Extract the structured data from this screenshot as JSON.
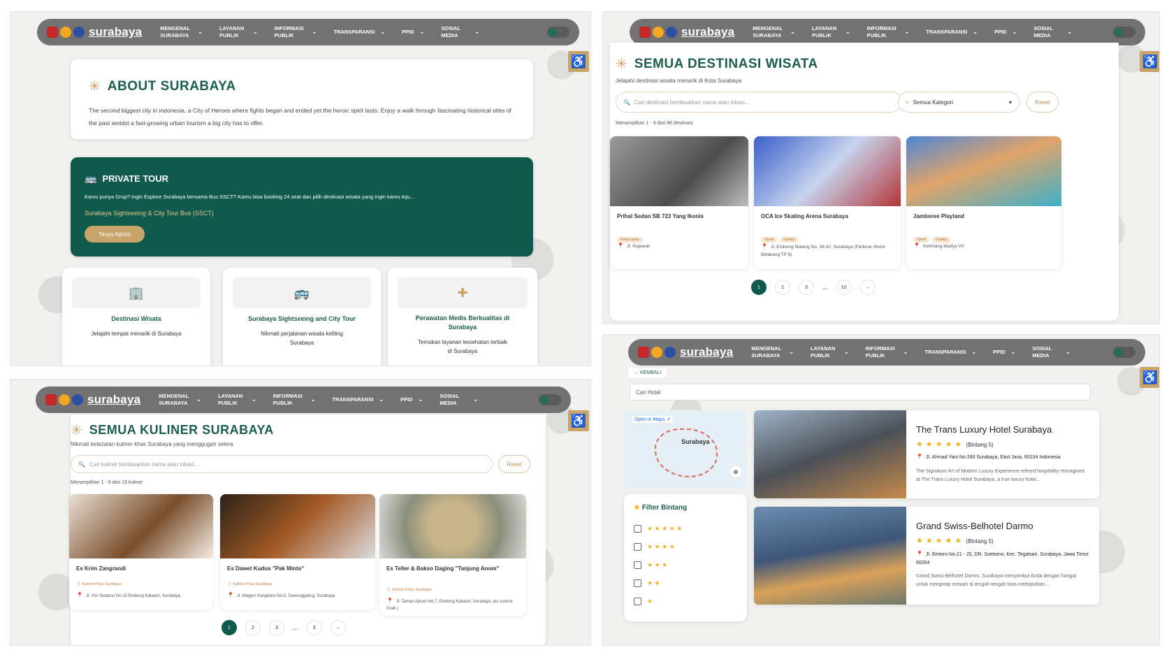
{
  "nav": {
    "brand": "surabaya",
    "menu": [
      "MENGENAL SURABAYA",
      "LAYANAN PUBLIK",
      "INFORMASI PUBLIK",
      "TRANSPARANSI",
      "PPID",
      "SOSIAL MEDIA"
    ]
  },
  "about": {
    "title": "ABOUT SURABAYA",
    "text": "The second biggest city in indonesia, a City of Heroes where fights began and ended yet the heroic spirit lasts. Enjoy a walk through fascinating historical sites of the past amidst a fast-growing urban tourism a big city has to offer.",
    "tour_title": "PRIVATE TOUR",
    "tour_text": "Kamu punya Grup? ingin Explore Surabaya bersama Bus SSCT? Kamu bisa booking 24 seat dan pilih destinasi wisata yang ingin kamu toju...",
    "tour_link": "Surabaya Sightseeing & City Tour Bus (SSCT)",
    "tour_btn": "Tanya Admin",
    "features": [
      {
        "title": "Destinasi Wisata",
        "desc": "Jelajahi tempat menarik di Surabaya"
      },
      {
        "title": "Surabaya Sightseeing and City Tour",
        "desc": "Nikmati perjalanan wisata keliling Surabaya"
      },
      {
        "title": "Perawatan Medis Berkualitas di Surabaya",
        "desc": "Temukan layanan kesehatan terbaik di Surabaya"
      }
    ]
  },
  "wisata": {
    "title": "SEMUA DESTINASI WISATA",
    "subtitle": "Jelajahi destinasi wisata menarik di Kota Surabaya",
    "placeholder": "Cari destinasi berdasarkan nama atau lokasi...",
    "category": "Semua Kategori",
    "reset": "Reset",
    "count": "Menampilkan 1 - 9 dari 86 destinasi",
    "items": [
      {
        "name": "Prihal Sedan SB 723 Yang Ikonis",
        "tags": [
          "Kota Lama"
        ],
        "loc": "Jl. Rajawali"
      },
      {
        "name": "OCA Ice Skating Arena Surabaya",
        "tags": [
          "Sport",
          "Family"
        ],
        "loc": "Jl. Embong Malang No. 39-42, Surabaya (Parkiran Motor Belakang TP 6)"
      },
      {
        "name": "Jamboree Playland",
        "tags": [
          "Sport",
          "Family"
        ],
        "loc": "Ketintang Madya VII"
      }
    ],
    "pages": [
      "1",
      "2",
      "3",
      "...",
      "10"
    ]
  },
  "kuliner": {
    "title": "SEMUA KULINER SURABAYA",
    "subtitle": "Nikmati kelezatan kuliner khas Surabaya yang menggugah selera",
    "placeholder": "Cari kuliner berdasarkan nama atau lokasi...",
    "reset": "Reset",
    "count": "Menampilkan 1 - 9 dari 19 kuliner",
    "items": [
      {
        "name": "Es Krim Zangrandi",
        "cat": "Kuliner Khas Surabaya",
        "loc": "Jl. Yos Sudarso No.15 Embong Kaliasin, Surabaya."
      },
      {
        "name": "Es Dawet Kudus \"Pak Minto\"",
        "cat": "Kuliner Khas Surabaya",
        "loc": "Jl. Mayjen Sungkono No.5, Sawunggaling, Surabaya."
      },
      {
        "name": "Es Teller & Bakso Daging \"Tanjung Anom\"",
        "cat": "Kuliner Khas Surabaya",
        "loc": "Jl. Taman Apsari No.7, Embong Kaliasin, Surabaya. pic source: Grab )"
      }
    ],
    "pages": [
      "1",
      "2",
      "3",
      "...",
      "3"
    ]
  },
  "hotel": {
    "back": "KEMBALI",
    "search": "Cari Hotel",
    "map_link": "Open in Maps",
    "map_label": "Surabaya",
    "filter_title": "Filter Bintang",
    "items": [
      {
        "name": "The Trans Luxury Hotel Surabaya",
        "rating": "(Bintang 5)",
        "addr": "Jl. Ahmad Yani No.260 Surabaya, East Java, 60234 Indonesia",
        "desc": "The Signature Art of Modern Luxury Experience refined hospitality reimagined at The Trans Luxury Hotel Surabaya, a true luxury hotel..."
      },
      {
        "name": "Grand Swiss-Belhotel Darmo",
        "rating": "(Bintang 5)",
        "addr": "Jl. Bintoro No.21 - 25, DR. Soetomo, Kec. Tegalsari, Surabaya, Jawa Timur 60264",
        "desc": "Grand Swiss-Belhotel Darmo, Surabaya menyambut Anda dengan hangat untuk menginap mewah di tengah-tengah kota metropolitan..."
      }
    ],
    "star_levels": [
      5,
      4,
      3,
      2,
      1
    ]
  }
}
